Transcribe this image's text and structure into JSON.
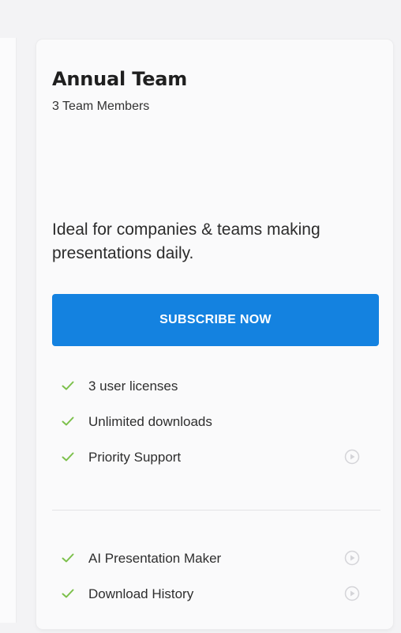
{
  "plan": {
    "title": "Annual Team",
    "subtitle": "3 Team Members",
    "description": "Ideal for companies & teams making presentations daily.",
    "cta_label": "SUBSCRIBE NOW"
  },
  "features": [
    {
      "label": "3 user licenses",
      "icon": "check-icon",
      "has_video": false
    },
    {
      "label": "Unlimited downloads",
      "icon": "check-icon",
      "has_video": false
    },
    {
      "label": "Priority Support",
      "icon": "check-icon",
      "has_video": true
    }
  ],
  "extra_features": [
    {
      "label": "AI Presentation Maker",
      "icon": "check-icon",
      "has_video": true
    },
    {
      "label": "Download History",
      "icon": "check-icon",
      "has_video": true
    }
  ],
  "colors": {
    "accent": "#1482e0",
    "check": "#7cc04b",
    "play_icon": "#d4d4d8"
  }
}
